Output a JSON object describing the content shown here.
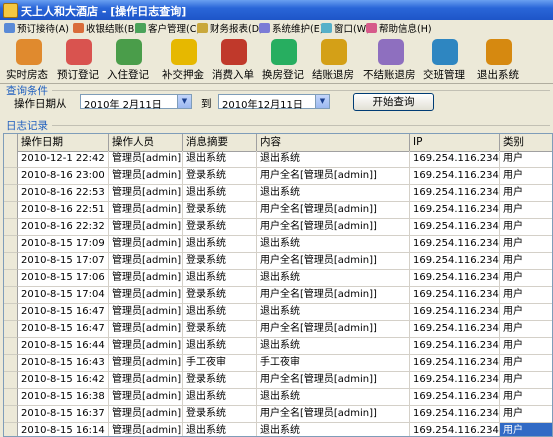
{
  "window": {
    "title": "天上人和大酒店 - [操作日志查询]"
  },
  "menu": [
    {
      "label": "预订接待(A)",
      "icon_color": "#5a8ad6"
    },
    {
      "label": "收银结账(B)",
      "icon_color": "#d96c3a"
    },
    {
      "label": "客户管理(C)",
      "icon_color": "#4aa35a"
    },
    {
      "label": "财务报表(D)",
      "icon_color": "#c9a83c"
    },
    {
      "label": "系统维护(E)",
      "icon_color": "#7b7bd6"
    },
    {
      "label": "窗口(W)",
      "icon_color": "#56b0c9"
    },
    {
      "label": "帮助信息(H)",
      "icon_color": "#d65a8a"
    }
  ],
  "toolbar": [
    {
      "label": "实时房态",
      "icon": "house-status-icon",
      "color": "#e08a2e"
    },
    {
      "label": "预订登记",
      "icon": "booking-icon",
      "color": "#d9534f"
    },
    {
      "label": "入住登记",
      "icon": "checkin-icon",
      "color": "#4a9d4a"
    },
    {
      "label": "补交押金",
      "icon": "deposit-icon",
      "color": "#e6b800"
    },
    {
      "label": "消费入单",
      "icon": "consumption-icon",
      "color": "#c0392b"
    },
    {
      "label": "换房登记",
      "icon": "change-room-icon",
      "color": "#27ae60"
    },
    {
      "label": "结账退房",
      "icon": "checkout-icon",
      "color": "#d4a017"
    },
    {
      "label": "不结账退房",
      "icon": "no-pay-checkout-icon",
      "color": "#8e6fbf"
    },
    {
      "label": "交班管理",
      "icon": "shift-icon",
      "color": "#2e86c1"
    },
    {
      "label": "退出系统",
      "icon": "exit-icon",
      "color": "#d68910"
    }
  ],
  "query": {
    "section_label": "查询条件",
    "date_label": "操作日期从",
    "from_date": "2010年 2月11日",
    "to_label": "到",
    "to_date": "2010年12月11日",
    "start_button": "开始查询"
  },
  "log": {
    "section_label": "日志记录",
    "columns": [
      "操作日期",
      "操作人员",
      "消息摘要",
      "内容",
      "IP",
      "类别"
    ],
    "rows": [
      [
        "2010-12-1 22:42",
        "管理员[admin]",
        "退出系统",
        "退出系统",
        "169.254.116.234",
        "用户"
      ],
      [
        "2010-8-16 23:00",
        "管理员[admin]",
        "登录系统",
        "用户全名[管理员[admin]]",
        "169.254.116.234",
        "用户"
      ],
      [
        "2010-8-16 22:53",
        "管理员[admin]",
        "退出系统",
        "退出系统",
        "169.254.116.234",
        "用户"
      ],
      [
        "2010-8-16 22:51",
        "管理员[admin]",
        "登录系统",
        "用户全名[管理员[admin]]",
        "169.254.116.234",
        "用户"
      ],
      [
        "2010-8-16 22:32",
        "管理员[admin]",
        "登录系统",
        "用户全名[管理员[admin]]",
        "169.254.116.234",
        "用户"
      ],
      [
        "2010-8-15 17:09",
        "管理员[admin]",
        "退出系统",
        "退出系统",
        "169.254.116.234",
        "用户"
      ],
      [
        "2010-8-15 17:07",
        "管理员[admin]",
        "登录系统",
        "用户全名[管理员[admin]]",
        "169.254.116.234",
        "用户"
      ],
      [
        "2010-8-15 17:06",
        "管理员[admin]",
        "退出系统",
        "退出系统",
        "169.254.116.234",
        "用户"
      ],
      [
        "2010-8-15 17:04",
        "管理员[admin]",
        "登录系统",
        "用户全名[管理员[admin]]",
        "169.254.116.234",
        "用户"
      ],
      [
        "2010-8-15 16:47",
        "管理员[admin]",
        "退出系统",
        "退出系统",
        "169.254.116.234",
        "用户"
      ],
      [
        "2010-8-15 16:47",
        "管理员[admin]",
        "登录系统",
        "用户全名[管理员[admin]]",
        "169.254.116.234",
        "用户"
      ],
      [
        "2010-8-15 16:44",
        "管理员[admin]",
        "退出系统",
        "退出系统",
        "169.254.116.234",
        "用户"
      ],
      [
        "2010-8-15 16:43",
        "管理员[admin]",
        "手工夜审",
        "手工夜审",
        "169.254.116.234",
        "用户"
      ],
      [
        "2010-8-15 16:42",
        "管理员[admin]",
        "登录系统",
        "用户全名[管理员[admin]]",
        "169.254.116.234",
        "用户"
      ],
      [
        "2010-8-15 16:38",
        "管理员[admin]",
        "退出系统",
        "退出系统",
        "169.254.116.234",
        "用户"
      ],
      [
        "2010-8-15 16:37",
        "管理员[admin]",
        "登录系统",
        "用户全名[管理员[admin]]",
        "169.254.116.234",
        "用户"
      ],
      [
        "2010-8-15 16:14",
        "管理员[admin]",
        "退出系统",
        "退出系统",
        "169.254.116.234",
        "用户"
      ]
    ],
    "selected_row": 16,
    "selected_col": 5
  }
}
